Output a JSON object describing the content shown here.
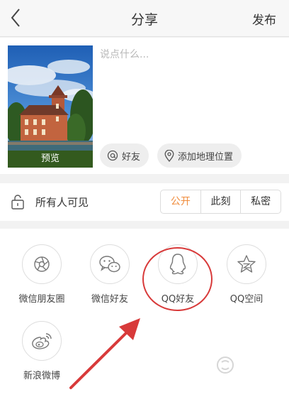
{
  "header": {
    "back_icon": "chevron-left-icon",
    "title": "分享",
    "publish_label": "发布"
  },
  "compose": {
    "preview_label": "预览",
    "placeholder": "说点什么...",
    "mention_chip": {
      "icon": "at-icon",
      "label": "好友"
    },
    "location_chip": {
      "icon": "location-pin-icon",
      "label": "添加地理位置"
    }
  },
  "visibility": {
    "icon": "unlock-icon",
    "label": "所有人可见",
    "options": [
      "公开",
      "此刻",
      "私密"
    ],
    "selected": "公开",
    "active_color": "#f08c3c"
  },
  "share_targets": [
    {
      "label": "微信朋友圈",
      "icon": "wechat-moments-icon"
    },
    {
      "label": "微信好友",
      "icon": "wechat-icon"
    },
    {
      "label": "QQ好友",
      "icon": "qq-icon"
    },
    {
      "label": "QQ空间",
      "icon": "qzone-star-icon"
    },
    {
      "label": "新浪微博",
      "icon": "weibo-icon"
    }
  ],
  "annotation": {
    "highlight_target": "QQ好友",
    "color": "#d83a3a"
  }
}
